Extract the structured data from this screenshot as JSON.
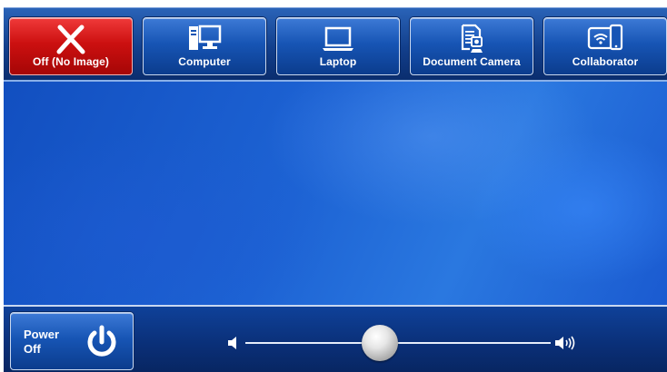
{
  "sources": [
    {
      "label": "Off (No Image)",
      "icon": "close-icon",
      "active": true
    },
    {
      "label": "Computer",
      "icon": "computer-icon",
      "active": false
    },
    {
      "label": "Laptop",
      "icon": "laptop-icon",
      "active": false
    },
    {
      "label": "Document Camera",
      "icon": "document-camera-icon",
      "active": false
    },
    {
      "label": "Collaborator",
      "icon": "collaborator-icon",
      "active": false
    }
  ],
  "power": {
    "label_line1": "Power",
    "label_line2": "Off",
    "icon": "power-icon"
  },
  "volume": {
    "level": 0.44,
    "min_icon": "volume-low-icon",
    "max_icon": "volume-high-icon"
  },
  "colors": {
    "active": "#cc1010",
    "button": "#1755b5",
    "background": "#1d63d4"
  }
}
